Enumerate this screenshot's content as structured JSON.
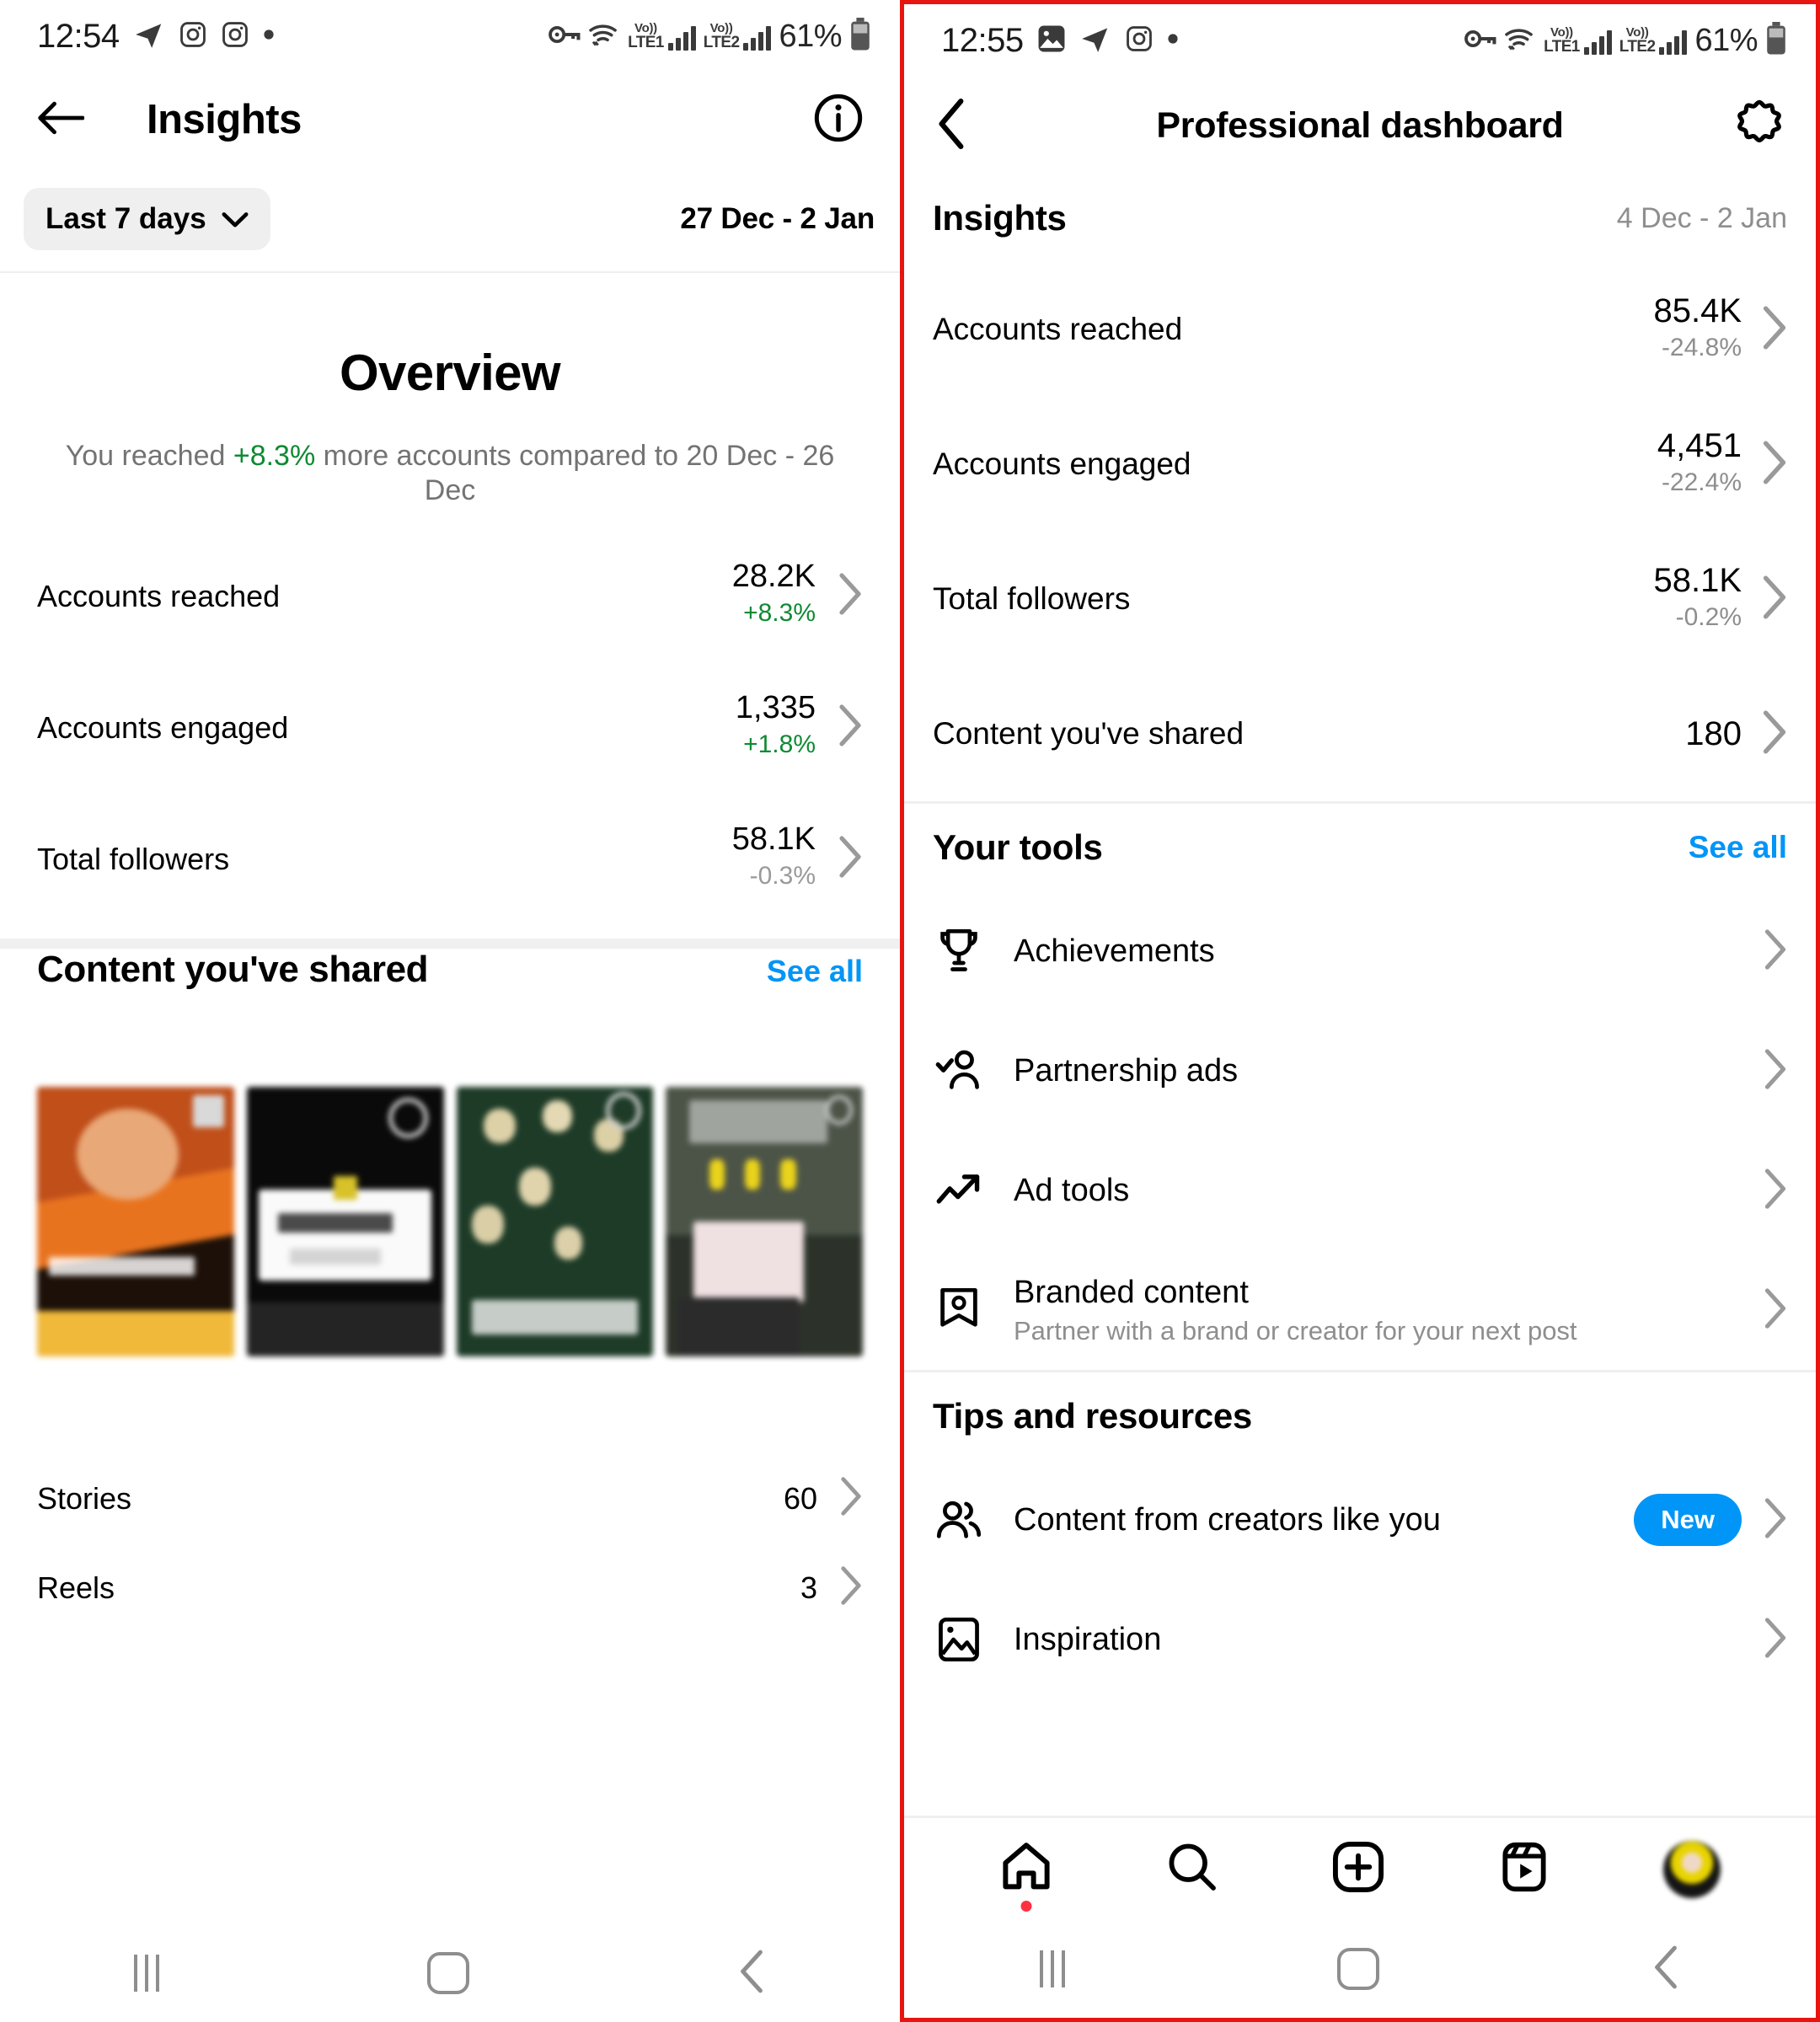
{
  "left": {
    "status": {
      "time": "12:54",
      "battery": "61%",
      "sim1": "LTE1",
      "sim2": "LTE2",
      "volte": "Vo))"
    },
    "appbar": {
      "title": "Insights",
      "back_icon": "arrow-left-icon",
      "info_icon": "info-circle-icon"
    },
    "filter": {
      "chip_label": "Last 7 days",
      "chevron_icon": "chevron-down-icon",
      "date_range": "27 Dec - 2 Jan"
    },
    "overview": {
      "title": "Overview",
      "sub_prefix": "You reached ",
      "sub_delta": "+8.3%",
      "sub_suffix": " more accounts compared to 20 Dec - 26 Dec"
    },
    "metrics": [
      {
        "label": "Accounts reached",
        "value": "28.2K",
        "delta": "+8.3%",
        "dir": "up"
      },
      {
        "label": "Accounts engaged",
        "value": "1,335",
        "delta": "+1.8%",
        "dir": "up"
      },
      {
        "label": "Total followers",
        "value": "58.1K",
        "delta": "-0.3%",
        "dir": "down"
      }
    ],
    "content_section": {
      "title": "Content you've shared",
      "see_all": "See all"
    },
    "rows": [
      {
        "label": "Stories",
        "value": "60"
      },
      {
        "label": "Reels",
        "value": "3"
      }
    ]
  },
  "right": {
    "status": {
      "time": "12:55",
      "battery": "61%",
      "sim1": "LTE1",
      "sim2": "LTE2",
      "volte": "Vo))"
    },
    "appbar": {
      "title": "Professional dashboard",
      "back_icon": "chevron-left-icon",
      "gear_icon": "gear-icon"
    },
    "insights": {
      "title": "Insights",
      "date_range": "4 Dec - 2 Jan"
    },
    "metrics": [
      {
        "label": "Accounts reached",
        "value": "85.4K",
        "delta": "-24.8%"
      },
      {
        "label": "Accounts engaged",
        "value": "4,451",
        "delta": "-22.4%"
      },
      {
        "label": "Total followers",
        "value": "58.1K",
        "delta": "-0.2%"
      },
      {
        "label": "Content you've shared",
        "value": "180",
        "delta": ""
      }
    ],
    "tools_section": {
      "title": "Your tools",
      "see_all": "See all"
    },
    "tools": [
      {
        "label": "Achievements",
        "sub": "",
        "icon": "trophy-icon",
        "badge": ""
      },
      {
        "label": "Partnership ads",
        "sub": "",
        "icon": "person-check-icon",
        "badge": ""
      },
      {
        "label": "Ad tools",
        "sub": "",
        "icon": "trending-up-icon",
        "badge": ""
      },
      {
        "label": "Branded content",
        "sub": "Partner with a brand or creator for your next post",
        "icon": "branded-content-icon",
        "badge": ""
      }
    ],
    "tips_section": {
      "title": "Tips and resources"
    },
    "tips": [
      {
        "label": "Content from creators like you",
        "icon": "people-icon",
        "badge": "New"
      },
      {
        "label": "Inspiration",
        "icon": "image-icon",
        "badge": ""
      }
    ],
    "bottomnav": [
      {
        "icon": "home-icon",
        "active": true
      },
      {
        "icon": "search-icon",
        "active": false
      },
      {
        "icon": "plus-square-icon",
        "active": false
      },
      {
        "icon": "reels-icon",
        "active": false
      },
      {
        "icon": "profile-avatar",
        "active": false
      }
    ]
  },
  "colors": {
    "accent": "#0095f6",
    "positive": "#0f8a33",
    "muted": "#8e8e8e",
    "frame": "#e8140f"
  }
}
